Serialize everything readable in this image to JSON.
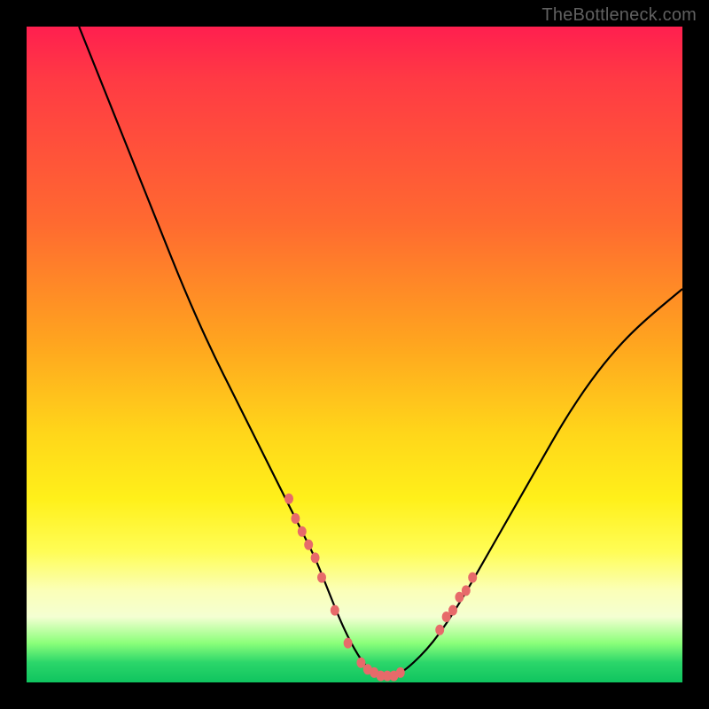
{
  "watermark": "TheBottleneck.com",
  "colors": {
    "background": "#000000",
    "gradient_top": "#ff1f4f",
    "gradient_mid_orange": "#ffa41f",
    "gradient_mid_yellow": "#fff01a",
    "gradient_pale_band": "#f4ffd2",
    "gradient_bottom": "#0fc45f",
    "curve": "#000000",
    "marker": "#e76a6a"
  },
  "chart_data": {
    "type": "line",
    "title": "",
    "xlabel": "",
    "ylabel": "",
    "xlim": [
      0,
      100
    ],
    "ylim": [
      0,
      100
    ],
    "grid": false,
    "legend": false,
    "series": [
      {
        "name": "bottleneck-curve",
        "x": [
          8,
          12,
          16,
          20,
          24,
          28,
          32,
          36,
          40,
          42,
          44,
          46,
          48,
          50,
          52,
          54,
          56,
          58,
          62,
          66,
          70,
          74,
          78,
          82,
          86,
          90,
          94,
          100
        ],
        "y": [
          100,
          90,
          80,
          70,
          60,
          51,
          43,
          35,
          27,
          23,
          19,
          14,
          9,
          5,
          2,
          1,
          1,
          2,
          6,
          12,
          19,
          26,
          33,
          40,
          46,
          51,
          55,
          60
        ]
      }
    ],
    "markers": {
      "name": "highlight-dots",
      "x": [
        40,
        41,
        42,
        43,
        44,
        45,
        47,
        49,
        51,
        52,
        53,
        54,
        55,
        56,
        57,
        63,
        64,
        65,
        66,
        67,
        68
      ],
      "y": [
        28,
        25,
        23,
        21,
        19,
        16,
        11,
        6,
        3,
        2,
        1.5,
        1,
        1,
        1,
        1.5,
        8,
        10,
        11,
        13,
        14,
        16
      ]
    },
    "annotations": []
  }
}
